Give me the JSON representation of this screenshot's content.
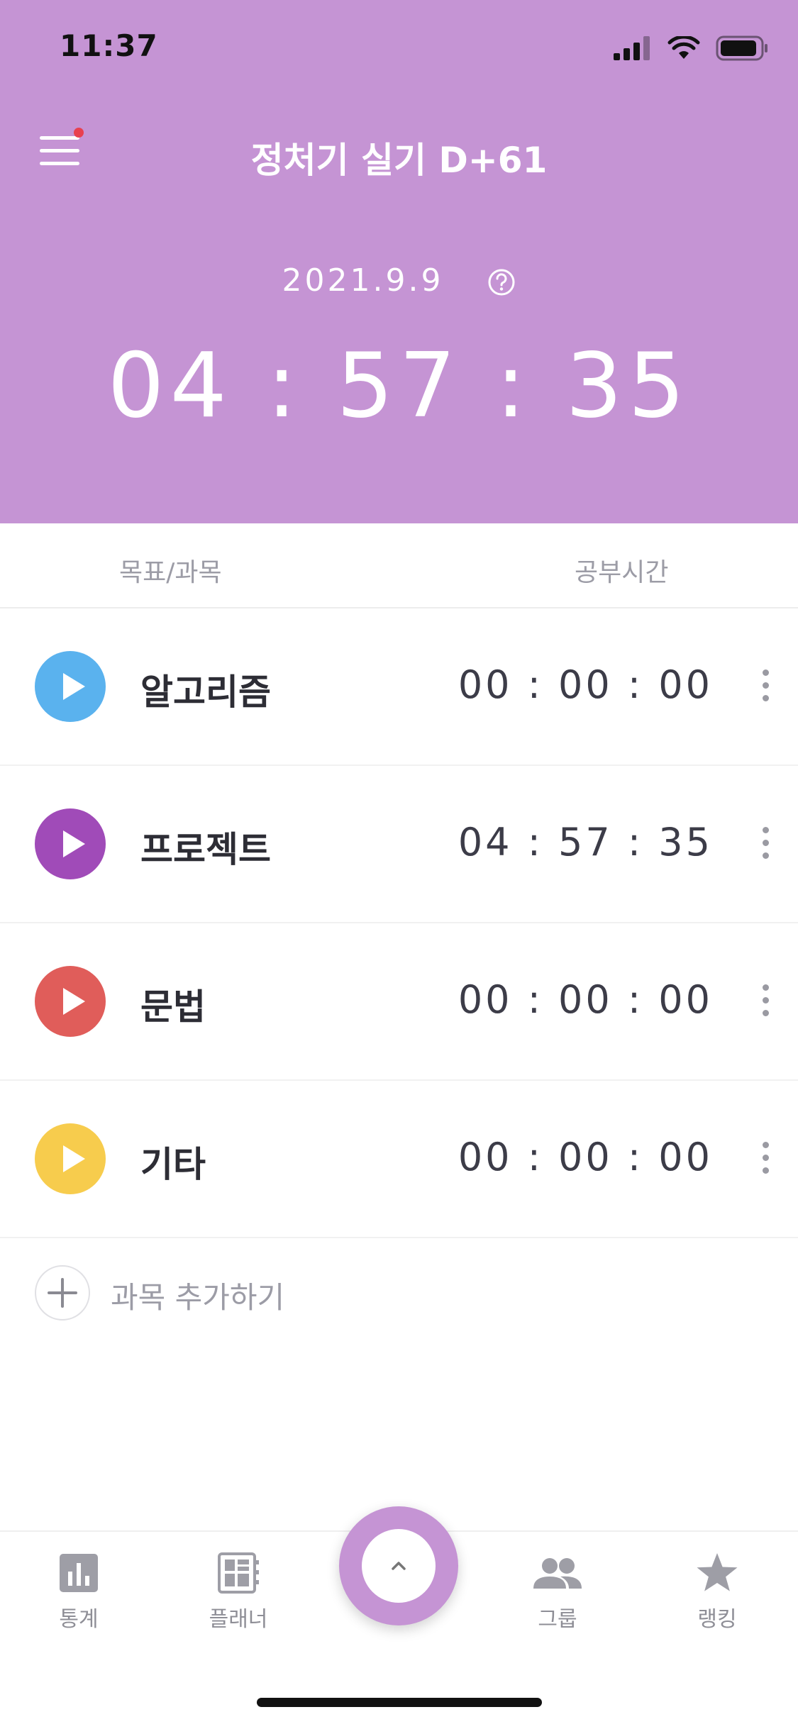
{
  "status_bar": {
    "time": "11:37"
  },
  "header": {
    "title": "정처기 실기 D+61",
    "date": "2021.9.9",
    "total_time": "04 : 57 : 35",
    "background": "#c594d4"
  },
  "columns": {
    "subject": "목표/과목",
    "study_time": "공부시간"
  },
  "subjects": [
    {
      "name": "알고리즘",
      "time": "00 : 00 : 00",
      "color": "#5ab2ee"
    },
    {
      "name": "프로젝트",
      "time": "04 : 57 : 35",
      "color": "#a04bb8"
    },
    {
      "name": "문법",
      "time": "00 : 00 : 00",
      "color": "#e05d5a"
    },
    {
      "name": "기타",
      "time": "00 : 00 : 00",
      "color": "#f7cc4d"
    }
  ],
  "add_subject_label": "과목 추가하기",
  "tabs": [
    {
      "label": "통계",
      "icon": "bar-chart-icon"
    },
    {
      "label": "플래너",
      "icon": "planner-icon"
    },
    {
      "label": "그룹",
      "icon": "group-icon"
    },
    {
      "label": "랭킹",
      "icon": "star-icon"
    }
  ]
}
